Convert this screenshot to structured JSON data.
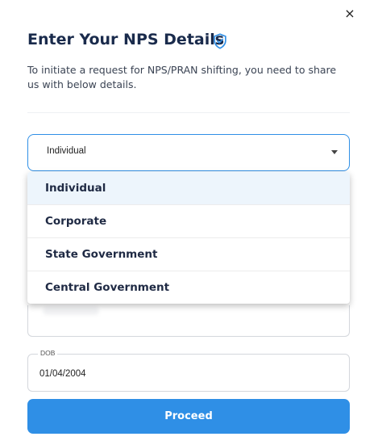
{
  "modal": {
    "close_glyph": "×",
    "title": "Enter Your NPS Details",
    "title_icon": "shield-check-icon",
    "subtitle": "To initiate a request for NPS/PRAN shifting, you need to share us with below details."
  },
  "category_select": {
    "value": "Individual",
    "options": [
      "Individual",
      "Corporate",
      "State Government",
      "Central Government"
    ],
    "selected_index": 0
  },
  "dob": {
    "label": "DOB",
    "value": "01/04/2004"
  },
  "proceed_label": "Proceed",
  "colors": {
    "accent": "#2f8fe6",
    "title": "#1a2b4c",
    "selected_option_bg": "#edf5fc"
  }
}
